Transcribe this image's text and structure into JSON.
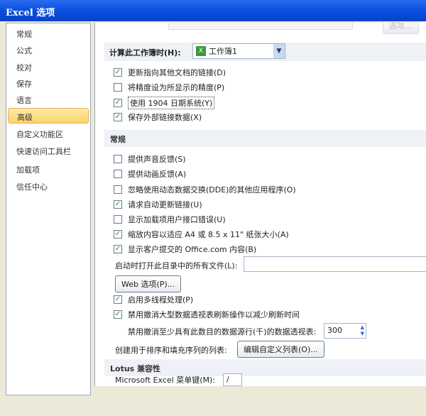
{
  "title": "Excel 选项",
  "sidebar": [
    "常规",
    "公式",
    "校对",
    "保存",
    "语言",
    "高级",
    "自定义功能区",
    "快速访问工具栏",
    "加载项",
    "信任中心"
  ],
  "top_button": "选项...",
  "calc": {
    "label": "计算此工作簿时(H):",
    "value": "工作簿1"
  },
  "calc_options": [
    {
      "label": "更新指向其他文档的链接(D)",
      "checked": true
    },
    {
      "label": "将精度设为所显示的精度(P)",
      "checked": false
    },
    {
      "label": "使用 1904 日期系统(Y)",
      "checked": true
    },
    {
      "label": "保存外部链接数据(X)",
      "checked": true
    }
  ],
  "general": {
    "title": "常规",
    "options": [
      {
        "label": "提供声音反馈(S)",
        "checked": false
      },
      {
        "label": "提供动画反馈(A)",
        "checked": false
      },
      {
        "label": "忽略使用动态数据交换(DDE)的其他应用程序(O)",
        "checked": false
      },
      {
        "label": "请求自动更新链接(U)",
        "checked": true
      },
      {
        "label": "显示加载项用户接口错误(U)",
        "checked": false
      },
      {
        "label": "缩放内容以适应 A4 或 8.5 x 11\" 纸张大小(A)",
        "checked": true
      },
      {
        "label": "显示客户提交的 Office.com 内容(B)",
        "checked": true
      }
    ],
    "startup_label": "启动时打开此目录中的所有文件(L):",
    "startup_value": "",
    "web_button": "Web 选项(P)...",
    "options2": [
      {
        "label": "启用多线程处理(P)",
        "checked": true
      },
      {
        "label": "禁用撤消大型数据透视表刷新操作以减少刷新时间",
        "checked": true
      }
    ],
    "undo_rows_label": "禁用撤消至少具有此数目的数据源行(千)的数据透视表:",
    "undo_rows_value": "300",
    "list_label": "创建用于排序和填充序列的列表:",
    "list_button": "编辑自定义列表(O)..."
  },
  "lotus": {
    "title": "Lotus 兼容性",
    "menu_key_label": "Microsoft Excel 菜单键(M):",
    "menu_key_value": "/"
  }
}
